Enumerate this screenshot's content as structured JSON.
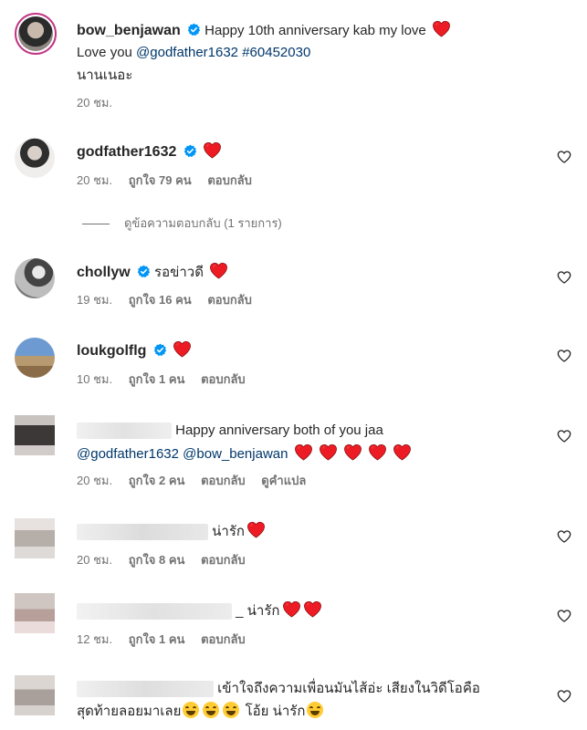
{
  "caption": {
    "username": "bow_benjawan",
    "text_line1": "Happy 10th anniversary kab my love",
    "text_line2_prefix": "Love you ",
    "mention": "@godfather1632",
    "hashtag": "#60452030",
    "text_line3": "นานเนอะ",
    "time": "20 ชม."
  },
  "comments": [
    {
      "username": "godfather1632",
      "verified": true,
      "text": "",
      "time": "20 ชม.",
      "likes": "ถูกใจ 79 คน",
      "reply": "ตอบกลับ",
      "view_replies": "ดูข้อความตอบกลับ (1 รายการ)"
    },
    {
      "username": "chollyw",
      "verified": true,
      "text": "รอข่าวดี",
      "time": "19 ชม.",
      "likes": "ถูกใจ 16 คน",
      "reply": "ตอบกลับ"
    },
    {
      "username": "loukgolflg",
      "verified": true,
      "text": "",
      "time": "10 ชม.",
      "likes": "ถูกใจ 1 คน",
      "reply": "ตอบกลับ"
    },
    {
      "username": "",
      "text": "Happy anniversary both of you jaa",
      "mention1": "@godfather1632",
      "mention2": "@bow_benjawan",
      "time": "20 ชม.",
      "likes": "ถูกใจ 2 คน",
      "reply": "ตอบกลับ",
      "translate": "ดูคำแปล"
    },
    {
      "username": "",
      "text": "น่ารัก",
      "time": "20 ชม.",
      "likes": "ถูกใจ 8 คน",
      "reply": "ตอบกลับ"
    },
    {
      "username": "",
      "text": "_ น่ารัก",
      "time": "12 ชม.",
      "likes": "ถูกใจ 1 คน",
      "reply": "ตอบกลับ"
    },
    {
      "username": "",
      "text_line1": "เข้าใจถึงความเพื่อนมันไส้อ่ะ เสียงในวิดีโอคือ",
      "text_line2a": "สุดท้ายลอยมาเลย",
      "text_line2b": "โอ้ย น่ารัก"
    }
  ],
  "colors": {
    "heart_red": "#ed1c24",
    "verified_blue": "#0095f6",
    "link": "#00376b",
    "meta_gray": "#737373"
  },
  "icons": {
    "like": "heart-outline-icon",
    "verified": "verified-badge-icon",
    "red_heart": "red-heart-emoji"
  }
}
